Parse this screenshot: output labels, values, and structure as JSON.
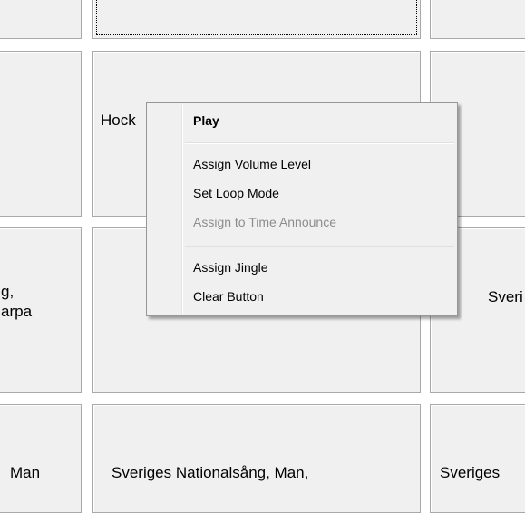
{
  "grid": {
    "r1c2_label": "Hock",
    "r2c1_label_line1": "g,",
    "r2c1_label_line2": "arpa",
    "r2c3_label": "Sveri",
    "r3c1_label": "Man",
    "r3c2_label": "Sveriges Nationalsång, Man,",
    "r3c3_label": "Sveriges"
  },
  "context_menu": {
    "play": "Play",
    "assign_volume_level": "Assign Volume Level",
    "set_loop_mode": "Set Loop Mode",
    "assign_time_announce": "Assign to Time Announce",
    "assign_jingle": "Assign Jingle",
    "clear_button": "Clear Button"
  }
}
